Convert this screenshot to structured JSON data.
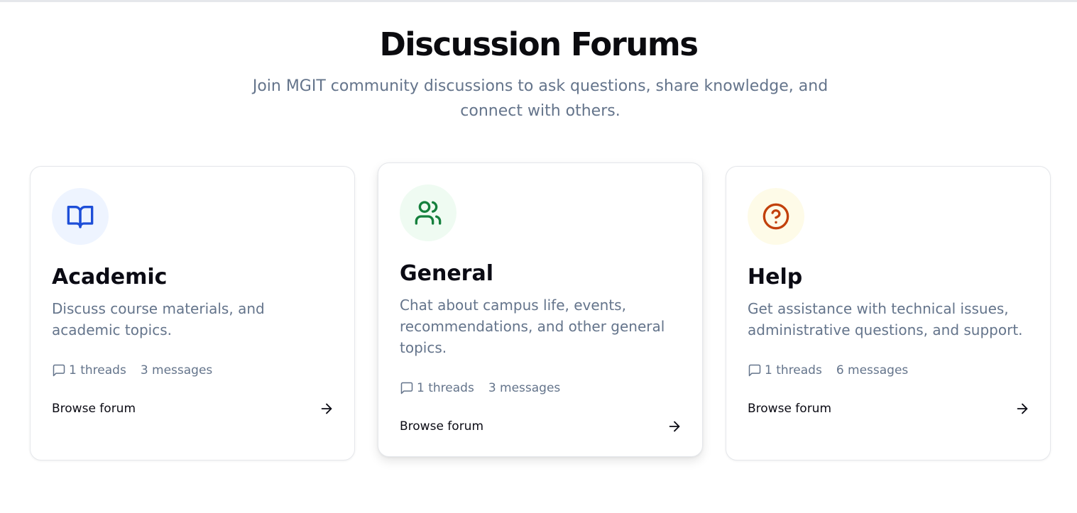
{
  "page": {
    "title": "Discussion Forums",
    "subtitle": "Join MGIT community discussions to ask questions, share knowledge, and connect with others."
  },
  "forums": [
    {
      "name": "Academic",
      "description": "Discuss course materials, and academic topics.",
      "threads": "1 threads",
      "messages": "3 messages",
      "browse_label": "Browse forum",
      "icon": "book-open-icon",
      "icon_color": "#1d4ed8",
      "icon_bg": "#eef4ff"
    },
    {
      "name": "General",
      "description": "Chat about campus life, events, recommendations, and other general topics.",
      "threads": "1 threads",
      "messages": "3 messages",
      "browse_label": "Browse forum",
      "icon": "users-icon",
      "icon_color": "#15803d",
      "icon_bg": "#effbf2"
    },
    {
      "name": "Help",
      "description": "Get assistance with technical issues, administrative questions, and support.",
      "threads": "1 threads",
      "messages": "6 messages",
      "browse_label": "Browse forum",
      "icon": "help-circle-icon",
      "icon_color": "#c2410c",
      "icon_bg": "#fefbe8"
    }
  ]
}
